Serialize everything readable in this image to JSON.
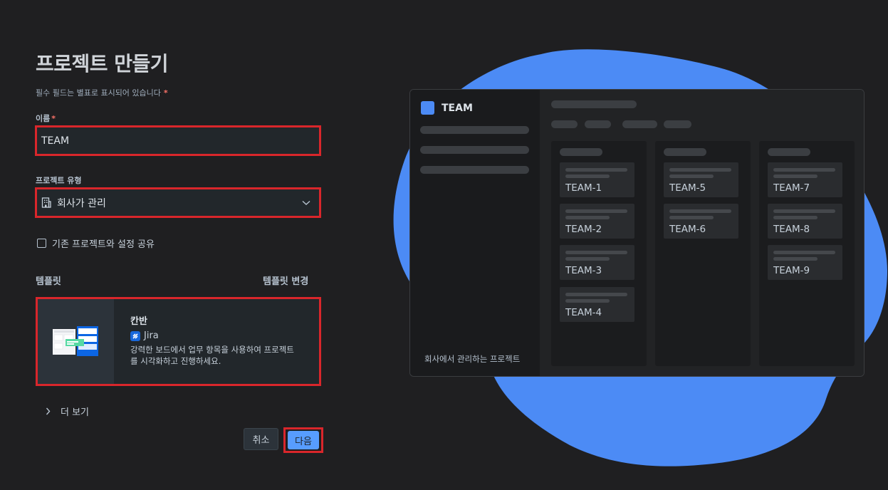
{
  "form": {
    "title": "프로젝트 만들기",
    "required_note": "필수 필드는 별표로 표시되어 있습니다",
    "required_star": "*",
    "name_label": "이름",
    "name_value": "TEAM",
    "type_label": "프로젝트 유형",
    "type_value": "회사가 관리",
    "share_checkbox_label": "기존 프로젝트와 설정 공유",
    "share_checked": false,
    "template_label": "템플릿",
    "template_change": "템플릿 변경",
    "template": {
      "name": "칸반",
      "product": "Jira",
      "description_line1": "강력한 보드에서 업무 항목을 사용하여 프로젝트",
      "description_line2": "를 시각화하고 진행하세요."
    },
    "more_label": "더 보기",
    "cancel_label": "취소",
    "next_label": "다음"
  },
  "preview": {
    "project_name": "TEAM",
    "footer": "회사에서 관리하는 프로젝트",
    "columns": [
      [
        "TEAM-1",
        "TEAM-2",
        "TEAM-3",
        "TEAM-4"
      ],
      [
        "TEAM-5",
        "TEAM-6"
      ],
      [
        "TEAM-7",
        "TEAM-8",
        "TEAM-9"
      ]
    ]
  },
  "colors": {
    "background": "#1f1f21",
    "highlight_border": "#d9262b",
    "primary_button": "#579dff",
    "blob": "#4c8bf5"
  },
  "icons": {
    "type_select": "building-icon",
    "dropdown": "chevron-down-icon",
    "more": "chevron-right-icon",
    "product": "jira-icon"
  }
}
